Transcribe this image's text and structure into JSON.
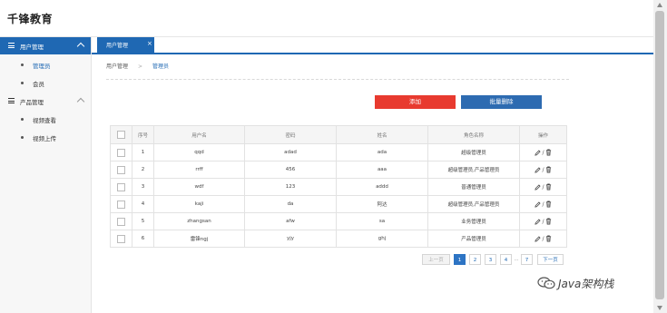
{
  "app": {
    "title": "千锋教育"
  },
  "sidebar": {
    "groups": [
      {
        "label": "用户管理",
        "items": [
          {
            "label": "管理员"
          },
          {
            "label": "会员"
          }
        ]
      },
      {
        "label": "产品管理",
        "items": [
          {
            "label": "视频查看"
          },
          {
            "label": "视频上传"
          }
        ]
      }
    ]
  },
  "tabs": [
    {
      "label": "用户管理",
      "close": "×"
    }
  ],
  "breadcrumb": {
    "parent": "用户管理",
    "separator": ">",
    "current": "管理员"
  },
  "toolbar": {
    "add_label": "添加",
    "bulk_delete_label": "批量删除"
  },
  "table": {
    "headers": {
      "index": "序号",
      "username": "用户名",
      "password": "密码",
      "nickname": "姓名",
      "role": "角色名称",
      "actions": "操作"
    },
    "rows": [
      {
        "index": "1",
        "username": "qqd",
        "password": "adad",
        "nickname": "ada",
        "role": "超级管理员"
      },
      {
        "index": "2",
        "username": "rrff",
        "password": "456",
        "nickname": "aaa",
        "role": "超级管理员,产品管理员"
      },
      {
        "index": "3",
        "username": "wdf",
        "password": "123",
        "nickname": "addd",
        "role": "普通管理员"
      },
      {
        "index": "4",
        "username": "kaji",
        "password": "da",
        "nickname": "阿达",
        "role": "超级管理员,产品管理员"
      },
      {
        "index": "5",
        "username": "zhangsan",
        "password": "afw",
        "nickname": "sa",
        "role": "业务管理员"
      },
      {
        "index": "6",
        "username": "雷锋ngj",
        "password": "yjy",
        "nickname": "ghj",
        "role": "产品管理员"
      }
    ],
    "action_separator": "/"
  },
  "pagination": {
    "prev": "上一页",
    "pages": [
      "1",
      "2",
      "3",
      "4"
    ],
    "ellipsis": "...",
    "last": "7",
    "next": "下一页",
    "current": "1"
  },
  "watermark": {
    "text": "Java架构栈"
  },
  "colors": {
    "primary": "#1f68b3",
    "danger": "#e83a2f",
    "bulk": "#2d6bb1"
  }
}
